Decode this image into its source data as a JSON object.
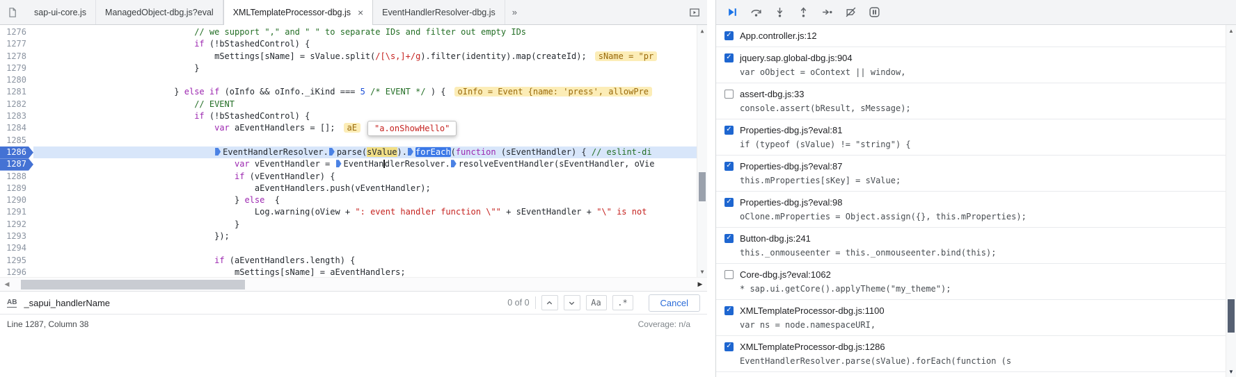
{
  "tabs": {
    "overflow_glyph": "»",
    "close_glyph": "×",
    "items": [
      {
        "label": "sap-ui-core.js"
      },
      {
        "label": "ManagedObject-dbg.js?eval"
      },
      {
        "label": "XMLTemplateProcessor-dbg.js",
        "active": true
      },
      {
        "label": "EventHandlerResolver-dbg.js"
      }
    ]
  },
  "editor": {
    "tooltip": {
      "text": "\"a.onShowHello\""
    },
    "lines": [
      {
        "n": 1276,
        "ind": 32,
        "seg": [
          [
            "c",
            "// we support \",\" and \" \" to separate IDs and filter out empty IDs"
          ]
        ]
      },
      {
        "n": 1277,
        "ind": 32,
        "seg": [
          [
            "k",
            "if"
          ],
          [
            "p",
            " (!bStashedControl) {"
          ]
        ]
      },
      {
        "n": 1278,
        "ind": 36,
        "seg": [
          [
            "p",
            "mSettings[sName] = sValue.split("
          ],
          [
            "r",
            "/[\\s,]+/g"
          ],
          [
            "p",
            ").filter(identity).map(createId);"
          ]
        ],
        "anno": "sName = \"pr"
      },
      {
        "n": 1279,
        "ind": 32,
        "seg": [
          [
            "p",
            "}"
          ]
        ]
      },
      {
        "n": 1280,
        "ind": 0,
        "seg": []
      },
      {
        "n": 1281,
        "ind": 28,
        "seg": [
          [
            "p",
            "} "
          ],
          [
            "k",
            "else"
          ],
          [
            "p",
            " "
          ],
          [
            "k",
            "if"
          ],
          [
            "p",
            " (oInfo && oInfo._iKind === "
          ],
          [
            "num",
            "5"
          ],
          [
            "p",
            " "
          ],
          [
            "c",
            "/* EVENT */"
          ],
          [
            "p",
            " ) {"
          ]
        ],
        "anno": "oInfo = Event {name: 'press', allowPre"
      },
      {
        "n": 1282,
        "ind": 32,
        "seg": [
          [
            "c",
            "// EVENT"
          ]
        ]
      },
      {
        "n": 1283,
        "ind": 32,
        "seg": [
          [
            "k",
            "if"
          ],
          [
            "p",
            " (!bStashedControl) {"
          ]
        ]
      },
      {
        "n": 1284,
        "ind": 36,
        "seg": [
          [
            "k",
            "var"
          ],
          [
            "p",
            " aEventHandlers = [];"
          ]
        ],
        "anno": "aE"
      },
      {
        "n": 1285,
        "ind": 0,
        "seg": []
      },
      {
        "n": 1286,
        "ind": 36,
        "cur": true,
        "bp": true,
        "seg": [
          [
            "m",
            ""
          ],
          [
            "p",
            "EventHandlerResolver."
          ],
          [
            "m",
            ""
          ],
          [
            "p",
            "parse("
          ],
          [
            "y",
            "sValue"
          ],
          [
            "p",
            ")."
          ],
          [
            "m",
            ""
          ],
          [
            "b",
            "forEach"
          ],
          [
            "p",
            "("
          ],
          [
            "k",
            "function"
          ],
          [
            "p",
            " (sEventHandler) { "
          ],
          [
            "c",
            "// eslint-di"
          ]
        ]
      },
      {
        "n": 1287,
        "ind": 40,
        "bp": true,
        "seg": [
          [
            "k",
            "var"
          ],
          [
            "p",
            " vEventHandler = "
          ],
          [
            "m",
            ""
          ],
          [
            "p",
            "EventHan"
          ],
          [
            "t",
            ""
          ],
          [
            "p",
            "dlerResolver."
          ],
          [
            "m",
            ""
          ],
          [
            "p",
            "resolveEventHandler(sEventHandler, oVie"
          ]
        ]
      },
      {
        "n": 1288,
        "ind": 40,
        "seg": [
          [
            "k",
            "if"
          ],
          [
            "p",
            " (vEventHandler) {"
          ]
        ]
      },
      {
        "n": 1289,
        "ind": 44,
        "seg": [
          [
            "p",
            "aEventHandlers.push(vEventHandler);"
          ]
        ]
      },
      {
        "n": 1290,
        "ind": 40,
        "seg": [
          [
            "p",
            "} "
          ],
          [
            "k",
            "else"
          ],
          [
            "p",
            "  {"
          ]
        ]
      },
      {
        "n": 1291,
        "ind": 44,
        "seg": [
          [
            "p",
            "Log.warning(oView + "
          ],
          [
            "s",
            "\": event handler function \\\"\""
          ],
          [
            "p",
            " + sEventHandler + "
          ],
          [
            "s",
            "\"\\\" is not"
          ]
        ]
      },
      {
        "n": 1292,
        "ind": 40,
        "seg": [
          [
            "p",
            "}"
          ]
        ]
      },
      {
        "n": 1293,
        "ind": 36,
        "seg": [
          [
            "p",
            "});"
          ]
        ]
      },
      {
        "n": 1294,
        "ind": 0,
        "seg": []
      },
      {
        "n": 1295,
        "ind": 36,
        "seg": [
          [
            "k",
            "if"
          ],
          [
            "p",
            " (aEventHandlers.length) {"
          ]
        ]
      },
      {
        "n": 1296,
        "ind": 40,
        "seg": [
          [
            "p",
            "mSettings[sName] = aEventHandlers;"
          ]
        ]
      }
    ]
  },
  "search": {
    "query": "_sapui_handlerName",
    "results": "0 of 0",
    "case_label": "Aa",
    "regex_label": ".*",
    "cancel_label": "Cancel"
  },
  "statusbar": {
    "line_col": "Line 1287, Column 38",
    "coverage": "Coverage: n/a"
  },
  "debugger": {
    "toolbar_icons": [
      "resume",
      "step-over",
      "step-into",
      "step-out",
      "step",
      "deactivate-breakpoints",
      "pause-on-exceptions"
    ],
    "breakpoints": [
      {
        "file": "App.controller.js:12",
        "checked": true,
        "snippet": ""
      },
      {
        "file": "jquery.sap.global-dbg.js:904",
        "checked": true,
        "snippet": "var oObject = oContext || window,"
      },
      {
        "file": "assert-dbg.js:33",
        "checked": false,
        "snippet": "console.assert(bResult, sMessage);"
      },
      {
        "file": "Properties-dbg.js?eval:81",
        "checked": true,
        "snippet": "if (typeof (sValue) != \"string\") {"
      },
      {
        "file": "Properties-dbg.js?eval:87",
        "checked": true,
        "snippet": "this.mProperties[sKey] = sValue;"
      },
      {
        "file": "Properties-dbg.js?eval:98",
        "checked": true,
        "snippet": "oClone.mProperties = Object.assign({}, this.mProperties);"
      },
      {
        "file": "Button-dbg.js:241",
        "checked": true,
        "snippet": "this._onmouseenter = this._onmouseenter.bind(this);"
      },
      {
        "file": "Core-dbg.js?eval:1062",
        "checked": false,
        "snippet": "* sap.ui.getCore().applyTheme(\"my_theme\");"
      },
      {
        "file": "XMLTemplateProcessor-dbg.js:1100",
        "checked": true,
        "snippet": "var ns = node.namespaceURI,"
      },
      {
        "file": "XMLTemplateProcessor-dbg.js:1286",
        "checked": true,
        "snippet": "EventHandlerResolver.parse(sValue).forEach(function (s"
      }
    ]
  },
  "colors": {
    "accent_blue": "#1a73e8",
    "breakpoint_blue": "#4472d4",
    "paused_line_blue": "#d8e6fa",
    "comment_green": "#236e25",
    "keyword_purple": "#9c27b0",
    "string_red": "#c5221f",
    "hint_background": "#fcedb7"
  }
}
